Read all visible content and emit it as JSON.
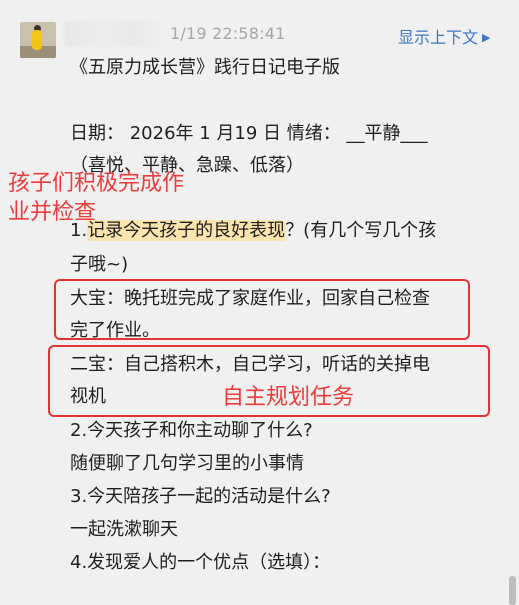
{
  "header": {
    "timestamp": "1/19 22:58:41",
    "context_link": "显示上下文",
    "context_icon": "caret-right-icon"
  },
  "message": {
    "title": "《五原力成长营》践行日记电子版",
    "date_line": "日期：  2026年 1 月19  日 情绪：  __平静___",
    "mood_options": "（喜悦、平静、急躁、低落）",
    "q1_prefix": "1.",
    "q1_highlight": "记录今天孩子的良好表现",
    "q1_suffix": "？(有几个写几个孩",
    "q1_cont": "子哦~)",
    "a1_line1": "大宝：晚托班完成了家庭作业，回家自己检查",
    "a1_line2": "完了作业。",
    "a2_line1": " 二宝：自己搭积木，自己学习，听话的关掉电",
    "a2_line2": "视机",
    "q2": " 2.今天孩子和你主动聊了什么?",
    "a3": "随便聊了几句学习里的小事情",
    "q3": " 3.今天陪孩子一起的活动是什么?",
    "a4": "一起洗漱聊天",
    "q4": "  4.发现爱人的一个优点（选填）："
  },
  "annotations": {
    "left_note_line1": "孩子们积极完成作",
    "left_note_line2": "业并检查",
    "right_note": "自主规划任务",
    "color": "#ee3b3b"
  }
}
